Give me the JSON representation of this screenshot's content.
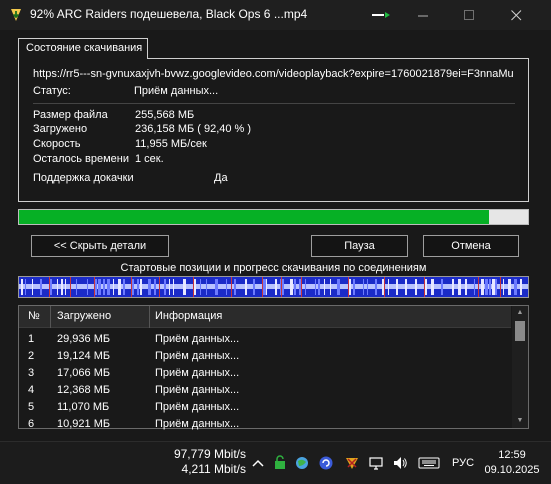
{
  "window": {
    "title": "92% ARC Raiders подешевела, Black Ops 6 ...mp4",
    "icons": {
      "app": "download-app-icon",
      "minimize": "minimize-icon",
      "maximize": "maximize-icon",
      "close": "close-icon"
    }
  },
  "status_tab": {
    "label": "Состояние скачивания"
  },
  "status": {
    "url": "https://rr5---sn-gvnuxaxjvh-bvwz.googlevideo.com/videoplayback?expire=1760021879ei=F3nnaMu",
    "status_label": "Статус:",
    "status_value": "Приём данных...",
    "file_size_label": "Размер файла",
    "file_size_value": "255,568  МБ",
    "downloaded_label": "Загружено",
    "downloaded_value": "236,158  МБ  ( 92,40 % )",
    "speed_label": "Скорость",
    "speed_value": "11,955  МБ/сек",
    "time_left_label": "Осталось времени",
    "time_left_value": "1 сек.",
    "resume_label": "Поддержка докачки",
    "resume_value": "Да"
  },
  "progress": {
    "percent": 92.4,
    "color": "#06b025"
  },
  "buttons": {
    "hide_details": "<< Скрыть детали",
    "pause": "Пауза",
    "cancel": "Отмена"
  },
  "connections": {
    "caption": "Стартовые позиции и прогресс скачивания по соединениям",
    "colors": {
      "base": "#1b2bc8",
      "marker": "#e8e8ff",
      "boundary": "#c8343c"
    }
  },
  "list": {
    "headers": [
      "№",
      "Загружено",
      "Информация"
    ],
    "rows": [
      {
        "n": "1",
        "downloaded": "29,936  МБ",
        "info": "Приём данных..."
      },
      {
        "n": "2",
        "downloaded": "19,124  МБ",
        "info": "Приём данных..."
      },
      {
        "n": "3",
        "downloaded": "17,066  МБ",
        "info": "Приём данных..."
      },
      {
        "n": "4",
        "downloaded": "12,368  МБ",
        "info": "Приём данных..."
      },
      {
        "n": "5",
        "downloaded": "11,070  МБ",
        "info": "Приём данных..."
      },
      {
        "n": "6",
        "downloaded": "10,921  МБ",
        "info": "Приём данных..."
      }
    ]
  },
  "taskbar": {
    "net_down": "97,779 Mbit/s",
    "net_up": "4,211 Mbit/s",
    "language": "РУС",
    "time": "12:59",
    "date": "09.10.2025",
    "tray_icons": [
      "chevron-up-icon",
      "security-icon",
      "globe-icon",
      "torrent-icon",
      "game-icon",
      "screen-icon",
      "volume-icon",
      "keyboard-icon"
    ]
  }
}
